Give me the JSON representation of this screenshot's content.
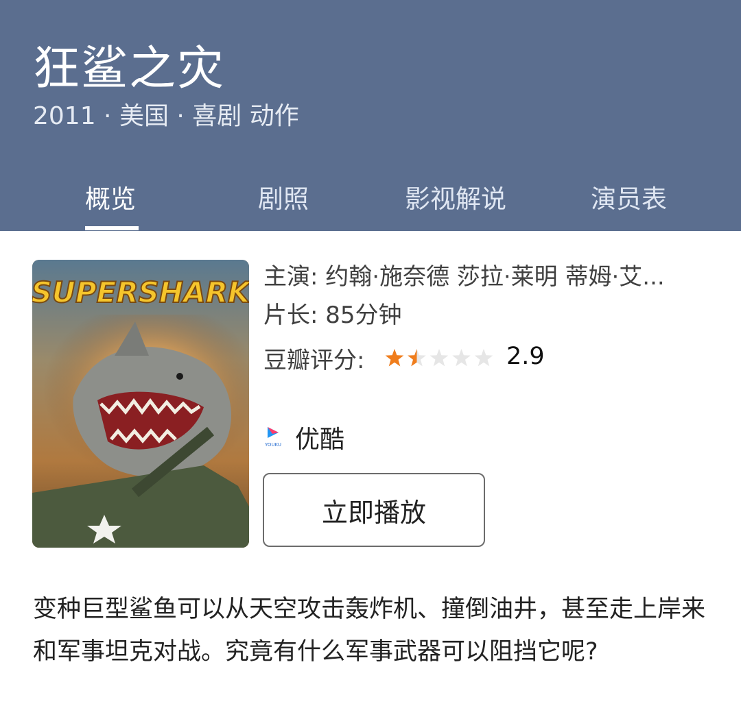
{
  "header": {
    "title": "狂鲨之灾",
    "meta": "2011 · 美国 · 喜剧 动作",
    "background_color": "#5b6e8f"
  },
  "tabs": [
    {
      "label": "概览",
      "active": true
    },
    {
      "label": "剧照",
      "active": false
    },
    {
      "label": "影视解说",
      "active": false
    },
    {
      "label": "演员表",
      "active": false
    }
  ],
  "poster": {
    "title_text": "SUPERSHARK"
  },
  "info": {
    "cast": "主演: 约翰·施奈德 莎拉·莱明 蒂姆·艾...",
    "duration": "片长: 85分钟",
    "rating_label": "豆瓣评分:",
    "rating_value": "2.9",
    "stars_filled": 1.5,
    "stars_total": 5,
    "star_color": "#f07d1c"
  },
  "provider": {
    "name": "优酷",
    "icon": "youku-logo-icon",
    "icon_caption": "YOUKU"
  },
  "actions": {
    "play_label": "立即播放"
  },
  "description": "变种巨型鲨鱼可以从天空攻击轰炸机、撞倒油井，甚至走上岸来和军事坦克对战。究竟有什么军事武器可以阻挡它呢?"
}
